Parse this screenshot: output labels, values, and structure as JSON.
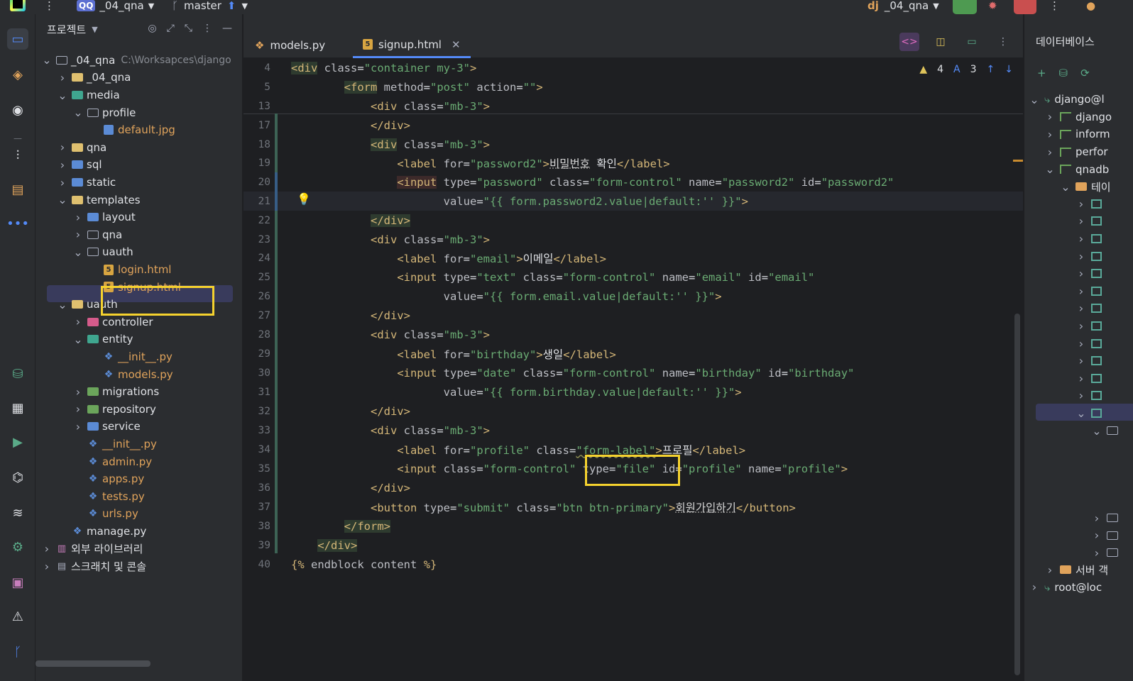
{
  "toolbar": {
    "project_badge": "QQ",
    "project_name": "_04_qna",
    "branch": "master",
    "run_config": "_04_qna"
  },
  "project_panel": {
    "title": "프로젝트",
    "tree": [
      {
        "label": "_04_qna",
        "path": "C:\\Worksapces\\django",
        "depth": 0,
        "chev": "v",
        "icon": "folder-grey"
      },
      {
        "label": "_04_qna",
        "depth": 1,
        "chev": ">",
        "icon": "folder"
      },
      {
        "label": "media",
        "depth": 1,
        "chev": "v",
        "icon": "folder-teal"
      },
      {
        "label": "profile",
        "depth": 2,
        "chev": "v",
        "icon": "folder-grey"
      },
      {
        "label": "default.jpg",
        "depth": 3,
        "chev": "",
        "icon": "image",
        "orange": true
      },
      {
        "label": "qna",
        "depth": 1,
        "chev": ">",
        "icon": "folder"
      },
      {
        "label": "sql",
        "depth": 1,
        "chev": ">",
        "icon": "folder-blue"
      },
      {
        "label": "static",
        "depth": 1,
        "chev": ">",
        "icon": "folder-blue"
      },
      {
        "label": "templates",
        "depth": 1,
        "chev": "v",
        "icon": "folder"
      },
      {
        "label": "layout",
        "depth": 2,
        "chev": ">",
        "icon": "folder-blue"
      },
      {
        "label": "qna",
        "depth": 2,
        "chev": ">",
        "icon": "folder-grey"
      },
      {
        "label": "uauth",
        "depth": 2,
        "chev": "v",
        "icon": "folder-grey"
      },
      {
        "label": "login.html",
        "depth": 3,
        "chev": "",
        "icon": "html",
        "orange": true
      },
      {
        "label": "signup.html",
        "depth": 3,
        "chev": "",
        "icon": "html",
        "orange": true,
        "selected": true
      },
      {
        "label": "uauth",
        "depth": 1,
        "chev": "v",
        "icon": "folder"
      },
      {
        "label": "controller",
        "depth": 2,
        "chev": ">",
        "icon": "folder-pink"
      },
      {
        "label": "entity",
        "depth": 2,
        "chev": "v",
        "icon": "folder-teal"
      },
      {
        "label": "__init__.py",
        "depth": 3,
        "chev": "",
        "icon": "python",
        "orange": true
      },
      {
        "label": "models.py",
        "depth": 3,
        "chev": "",
        "icon": "python",
        "orange": true
      },
      {
        "label": "migrations",
        "depth": 2,
        "chev": ">",
        "icon": "folder-green"
      },
      {
        "label": "repository",
        "depth": 2,
        "chev": ">",
        "icon": "folder-green"
      },
      {
        "label": "service",
        "depth": 2,
        "chev": ">",
        "icon": "folder-blue"
      },
      {
        "label": "__init__.py",
        "depth": 2,
        "chev": "",
        "icon": "python",
        "orange": true
      },
      {
        "label": "admin.py",
        "depth": 2,
        "chev": "",
        "icon": "python",
        "orange": true
      },
      {
        "label": "apps.py",
        "depth": 2,
        "chev": "",
        "icon": "python",
        "orange": true
      },
      {
        "label": "tests.py",
        "depth": 2,
        "chev": "",
        "icon": "python",
        "orange": true
      },
      {
        "label": "urls.py",
        "depth": 2,
        "chev": "",
        "icon": "python",
        "orange": true
      },
      {
        "label": "manage.py",
        "depth": 1,
        "chev": "",
        "icon": "python"
      },
      {
        "label": "외부 라이브러리",
        "depth": 0,
        "chev": ">",
        "icon": "library"
      },
      {
        "label": "스크래치 및 콘솔",
        "depth": 0,
        "chev": ">",
        "icon": "scratch"
      }
    ]
  },
  "editor": {
    "tabs": [
      {
        "label": "models.py",
        "active": false
      },
      {
        "label": "signup.html",
        "active": true
      }
    ],
    "inspections": {
      "warnings": "4",
      "typos": "3"
    },
    "lines": [
      {
        "num": "4",
        "html": "<span class=\"t tg\">&lt;div</span> <span class=\"a\">class</span>=<span class=\"v\">\"container my-3\"</span><span class=\"t\">&gt;</span>"
      },
      {
        "num": "5",
        "html": "        <span class=\"t tg\">&lt;form</span> <span class=\"a\">method</span>=<span class=\"v\">\"post\"</span> <span class=\"a\">action</span>=<span class=\"v\">\"\"</span><span class=\"t\">&gt;</span>"
      },
      {
        "num": "13",
        "html": "            <span class=\"t\">&lt;div</span> <span class=\"a\">class</span>=<span class=\"v\">\"mb-3\"</span><span class=\"t\">&gt;</span>"
      },
      {
        "num": "17",
        "html": "            <span class=\"t\">&lt;/div&gt;</span>"
      },
      {
        "num": "18",
        "html": "            <span class=\"t tg\">&lt;div</span> <span class=\"a\">class</span>=<span class=\"v\">\"mb-3\"</span><span class=\"t\">&gt;</span>"
      },
      {
        "num": "19",
        "html": "                <span class=\"t\">&lt;label</span> <span class=\"a\">for</span>=<span class=\"v\">\"password2\"</span><span class=\"t\">&gt;</span><span class=\"kr\">비밀번호</span> 확인<span class=\"t\">&lt;/label&gt;</span>"
      },
      {
        "num": "20",
        "html": "                <span class=\"t\" style=\"background:#3d2a2a\">&lt;input</span> <span class=\"a\">type</span>=<span class=\"v\">\"password\"</span> <span class=\"a\">class</span>=<span class=\"v\">\"form-control\"</span> <span class=\"a\">name</span>=<span class=\"v\">\"password2\"</span> <span class=\"a\">id</span>=<span class=\"v\">\"password2\"</span>"
      },
      {
        "num": "21",
        "html": "                       <span class=\"a\">value</span>=<span class=\"v\">\"{{ form.password2.value|default:'' }}\"</span><span class=\"t\">&gt;</span>"
      },
      {
        "num": "22",
        "html": "            <span class=\"t tg\">&lt;/div&gt;</span>"
      },
      {
        "num": "23",
        "html": "            <span class=\"t\">&lt;div</span> <span class=\"a\">class</span>=<span class=\"v\">\"mb-3\"</span><span class=\"t\">&gt;</span>"
      },
      {
        "num": "24",
        "html": "                <span class=\"t\">&lt;label</span> <span class=\"a\">for</span>=<span class=\"v\">\"email\"</span><span class=\"t\">&gt;</span>이메일<span class=\"t\">&lt;/label&gt;</span>"
      },
      {
        "num": "25",
        "html": "                <span class=\"t\">&lt;input</span> <span class=\"a\">type</span>=<span class=\"v\">\"text\"</span> <span class=\"a\">class</span>=<span class=\"v\">\"form-control\"</span> <span class=\"a\">name</span>=<span class=\"v\">\"email\"</span> <span class=\"a\">id</span>=<span class=\"v\">\"email\"</span>"
      },
      {
        "num": "26",
        "html": "                       <span class=\"a\">value</span>=<span class=\"v\">\"{{ form.email.value|default:'' }}\"</span><span class=\"t\">&gt;</span>"
      },
      {
        "num": "27",
        "html": "            <span class=\"t\">&lt;/div&gt;</span>"
      },
      {
        "num": "28",
        "html": "            <span class=\"t\">&lt;div</span> <span class=\"a\">class</span>=<span class=\"v\">\"mb-3\"</span><span class=\"t\">&gt;</span>"
      },
      {
        "num": "29",
        "html": "                <span class=\"t\">&lt;label</span> <span class=\"a\">for</span>=<span class=\"v\">\"birthday\"</span><span class=\"t\">&gt;</span>생일<span class=\"t\">&lt;/label&gt;</span>"
      },
      {
        "num": "30",
        "html": "                <span class=\"t\">&lt;input</span> <span class=\"a\">type</span>=<span class=\"v\">\"date\"</span> <span class=\"a\">class</span>=<span class=\"v\">\"form-control\"</span> <span class=\"a\">name</span>=<span class=\"v\">\"birthday\"</span> <span class=\"a\">id</span>=<span class=\"v\">\"birthday\"</span>"
      },
      {
        "num": "31",
        "html": "                       <span class=\"a\">value</span>=<span class=\"v\">\"{{ form.birthday.value|default:'' }}\"</span><span class=\"t\">&gt;</span>"
      },
      {
        "num": "32",
        "html": "            <span class=\"t\">&lt;/div&gt;</span>"
      },
      {
        "num": "33",
        "html": "            <span class=\"t\">&lt;div</span> <span class=\"a\">class</span>=<span class=\"v\">\"mb-3\"</span><span class=\"t\">&gt;</span>"
      },
      {
        "num": "34",
        "html": "                <span class=\"t\">&lt;label</span> <span class=\"a\">for</span>=<span class=\"v\">\"profile\"</span> <span class=\"a\">class</span>=<span class=\"v\" style=\"text-decoration:underline wavy #8a8a50\">\"form-label\"</span><span class=\"t\">&gt;</span>프로필<span class=\"t\">&lt;/label&gt;</span>"
      },
      {
        "num": "35",
        "html": "                <span class=\"t\">&lt;input</span> <span class=\"a\">class</span>=<span class=\"v\">\"form-control\"</span> <span class=\"a\">type</span>=<span class=\"v\">\"file\"</span> <span class=\"a\">id</span>=<span class=\"v\">\"profile\"</span> <span class=\"a\">name</span>=<span class=\"v\">\"profile\"</span><span class=\"t\">&gt;</span>"
      },
      {
        "num": "36",
        "html": "            <span class=\"t\">&lt;/div&gt;</span>"
      },
      {
        "num": "37",
        "html": "            <span class=\"t\">&lt;button</span> <span class=\"a\">type</span>=<span class=\"v\">\"submit\"</span> <span class=\"a\">class</span>=<span class=\"v\">\"btn btn-primary\"</span><span class=\"t\">&gt;</span><span class=\"kr\">회원가입하기</span><span class=\"t\">&lt;/button&gt;</span>"
      },
      {
        "num": "38",
        "html": "        <span class=\"t tg\">&lt;/form&gt;</span>"
      },
      {
        "num": "39",
        "html": "    <span class=\"t tg\">&lt;/div&gt;</span>"
      },
      {
        "num": "40",
        "html": "<span class=\"t\">{%</span> <span class=\"a\">endblock</span> <span class=\"a\">content</span> <span class=\"t\">%}</span>"
      }
    ]
  },
  "database_panel": {
    "title": "데이터베이스",
    "rows": [
      {
        "label": "django@l",
        "depth": 0,
        "chev": "v",
        "icon": "connection"
      },
      {
        "label": "django",
        "depth": 1,
        "chev": ">",
        "icon": "schema"
      },
      {
        "label": "inform",
        "depth": 1,
        "chev": ">",
        "icon": "schema"
      },
      {
        "label": "perfor",
        "depth": 1,
        "chev": ">",
        "icon": "schema"
      },
      {
        "label": "qnadb",
        "depth": 1,
        "chev": "v",
        "icon": "schema"
      },
      {
        "label": "테이",
        "depth": 2,
        "chev": "v",
        "icon": "folder"
      }
    ],
    "bottom_rows": [
      {
        "label": "서버 객",
        "depth": 1,
        "chev": ">",
        "icon": "folder"
      },
      {
        "label": "root@loc",
        "depth": 0,
        "chev": ">",
        "icon": "connection"
      }
    ]
  }
}
